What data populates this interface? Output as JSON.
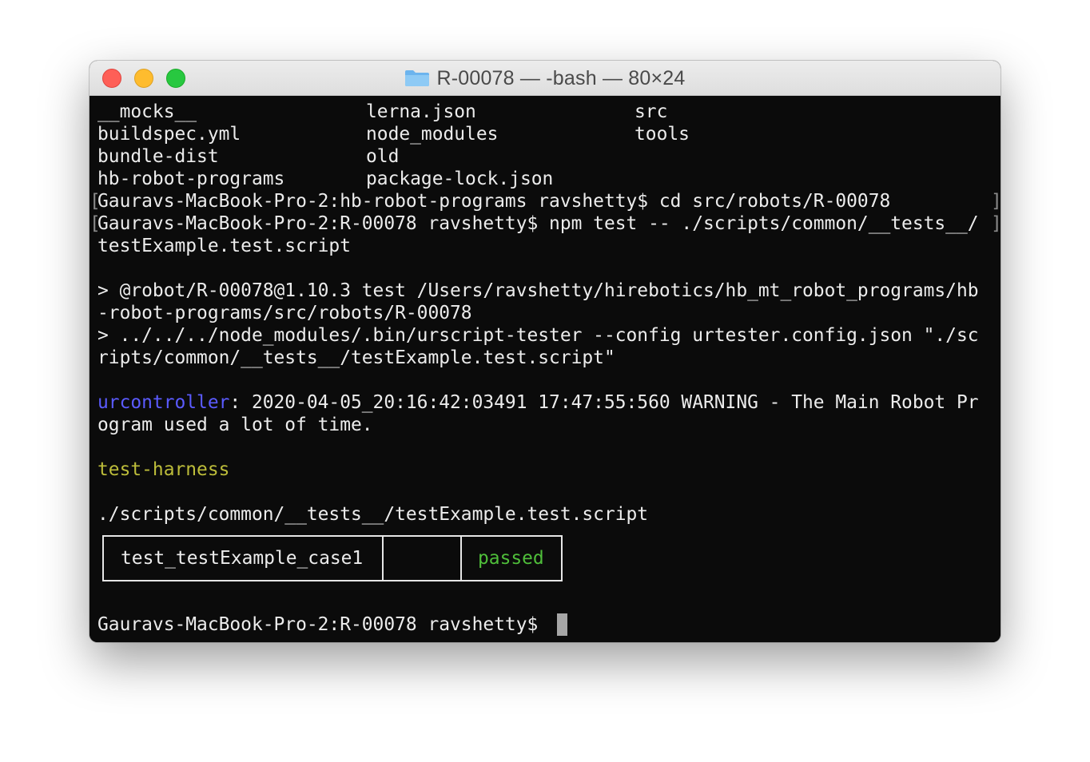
{
  "window": {
    "title": "R-00078 — -bash — 80×24"
  },
  "terminal": {
    "listing": [
      [
        "__mocks__",
        "lerna.json",
        "src"
      ],
      [
        "buildspec.yml",
        "node_modules",
        "tools"
      ],
      [
        "bundle-dist",
        "old",
        ""
      ],
      [
        "hb-robot-programs",
        "package-lock.json",
        ""
      ]
    ],
    "cmd1": "Gauravs-MacBook-Pro-2:hb-robot-programs ravshetty$ cd src/robots/R-00078",
    "cmd2": "Gauravs-MacBook-Pro-2:R-00078 ravshetty$ npm test -- ./scripts/common/__tests__/",
    "cmd2_wrap": "testExample.test.script",
    "npm_line1": "> @robot/R-00078@1.10.3 test /Users/ravshetty/hirebotics/hb_mt_robot_programs/hb",
    "npm_line1_wrap": "-robot-programs/src/robots/R-00078",
    "npm_line2": "> ../../../node_modules/.bin/urscript-tester --config urtester.config.json \"./sc",
    "npm_line2_wrap": "ripts/common/__tests__/testExample.test.script\"",
    "warning_source": "urcontroller",
    "warning_text": ": 2020-04-05_20:16:42:03491 17:47:55:560 WARNING - The Main Robot Pr",
    "warning_wrap": "ogram used a lot of time.",
    "harness_label": "test-harness",
    "script_path": "./scripts/common/__tests__/testExample.test.script",
    "result": {
      "case_name": "test_testExample_case1",
      "middle": "",
      "status": "passed"
    },
    "prompt": "Gauravs-MacBook-Pro-2:R-00078 ravshetty$ "
  },
  "colors": {
    "warning_source": "#5b5bff",
    "harness": "#bdbd3a",
    "passed": "#4fbe3a"
  },
  "icons": {
    "title_folder": "folder-icon"
  }
}
